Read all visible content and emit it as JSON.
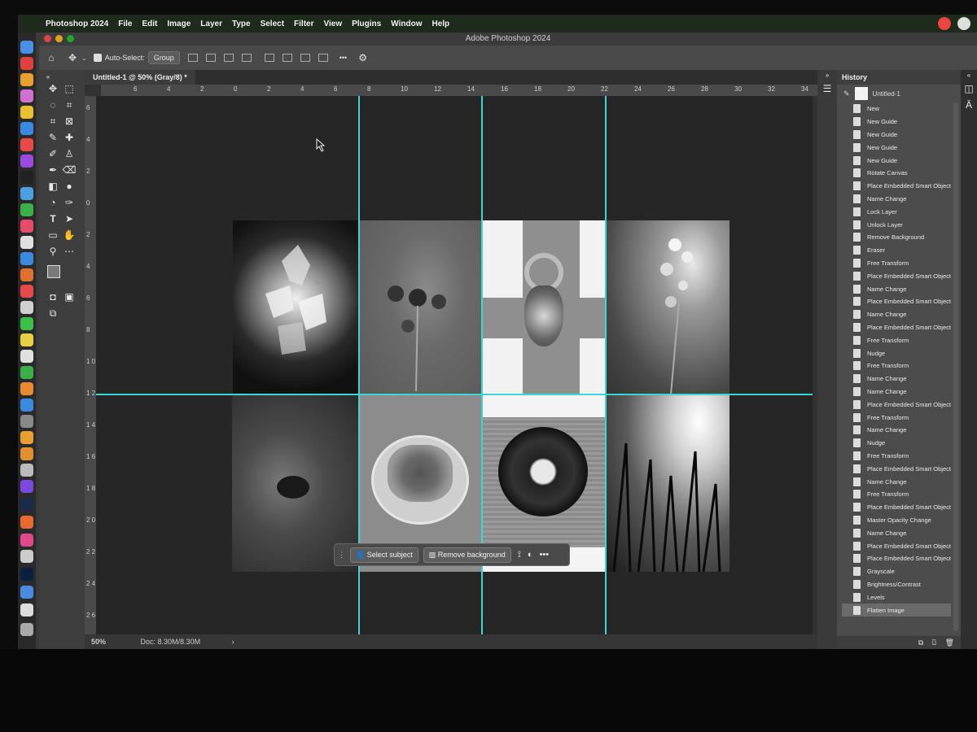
{
  "menubar": {
    "app_name": "Photoshop 2024",
    "items": [
      "File",
      "Edit",
      "Image",
      "Layer",
      "Type",
      "Select",
      "Filter",
      "View",
      "Plugins",
      "Window",
      "Help"
    ]
  },
  "window": {
    "title": "Adobe Photoshop 2024"
  },
  "optionsbar": {
    "auto_select_label": "Auto-Select:",
    "auto_select_value": "Group",
    "more": "•••"
  },
  "document": {
    "tab_label": "Untitled-1 @ 50% (Gray/8) *"
  },
  "rulers": {
    "top": [
      "6",
      "4",
      "2",
      "0",
      "2",
      "4",
      "6",
      "8",
      "10",
      "12",
      "14",
      "16",
      "18",
      "20",
      "22",
      "24",
      "26",
      "28",
      "30",
      "32",
      "34"
    ],
    "left": [
      "6",
      "4",
      "2",
      "0",
      "2",
      "4",
      "6",
      "8",
      "1 0",
      "1 2",
      "1 4",
      "1 6",
      "1 8",
      "2 0",
      "2 2",
      "2 4",
      "2 6"
    ]
  },
  "context_bar": {
    "select_subject": "Select subject",
    "remove_background": "Remove background",
    "more": "•••"
  },
  "status": {
    "zoom": "50%",
    "doc": "Doc: 8.30M/8.30M"
  },
  "history": {
    "title": "History",
    "snapshot": "Untitled-1",
    "items": [
      "New",
      "New Guide",
      "New Guide",
      "New Guide",
      "New Guide",
      "Rotate Canvas",
      "Place Embedded Smart Object",
      "Name Change",
      "Lock Layer",
      "Unlock Layer",
      "Remove Background",
      "Eraser",
      "Free Transform",
      "Place Embedded Smart Object",
      "Name Change",
      "Place Embedded Smart Object",
      "Name Change",
      "Place Embedded Smart Object",
      "Free Transform",
      "Nudge",
      "Free Transform",
      "Name Change",
      "Name Change",
      "Place Embedded Smart Object",
      "Free Transform",
      "Name Change",
      "Nudge",
      "Free Transform",
      "Place Embedded Smart Object",
      "Name Change",
      "Free Transform",
      "Place Embedded Smart Object",
      "Master Opacity Change",
      "Name Change",
      "Place Embedded Smart Object",
      "Place Embedded Smart Object",
      "Grayscale",
      "Brightness/Contrast",
      "Levels",
      "Flatten Image"
    ],
    "active_index": 39
  },
  "colors": {
    "guide": "#3cd6d6",
    "ps_blue": "#31a8ff"
  }
}
